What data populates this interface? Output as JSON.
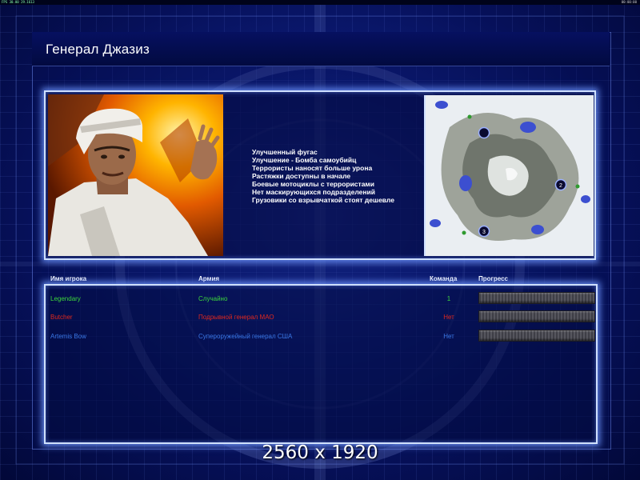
{
  "topbar": {
    "left_text": "FPS 30.00 29.1613",
    "right_text": "00:00:00"
  },
  "title": "Генерал Джазиз",
  "briefing": {
    "portrait_icon": "general-jazeez-portrait",
    "features": [
      "Улучшенный фугас",
      "Улучшение - Бомба самоубийц",
      "Террористы наносят больше урона",
      "Растяжки доступны в начале",
      "Боевые мотоциклы с террористами",
      "Нет маскирующихся подразделений",
      "Грузовики со взрывчаткой стоят дешевле"
    ],
    "minimap": {
      "icon": "map-preview",
      "start_positions": [
        "",
        "2",
        "3"
      ]
    }
  },
  "players": {
    "headers": {
      "name": "Имя игрока",
      "army": "Армия",
      "team": "Команда",
      "progress": "Прогресс"
    },
    "rows": [
      {
        "name": "Legendary",
        "army": "Случайно",
        "team": "1",
        "color": "#3cd63c"
      },
      {
        "name": "Butcher",
        "army": "Подрывной генерал МАО",
        "team": "Нет",
        "color": "#e0281e"
      },
      {
        "name": "Artemis Bow",
        "army": "Супероружейный генерал США",
        "team": "Нет",
        "color": "#3a78e6"
      }
    ]
  },
  "watermark": "2560 x 1920",
  "colors": {
    "frame_glow": "#cfe0ff",
    "background": "#0d1d7a"
  }
}
